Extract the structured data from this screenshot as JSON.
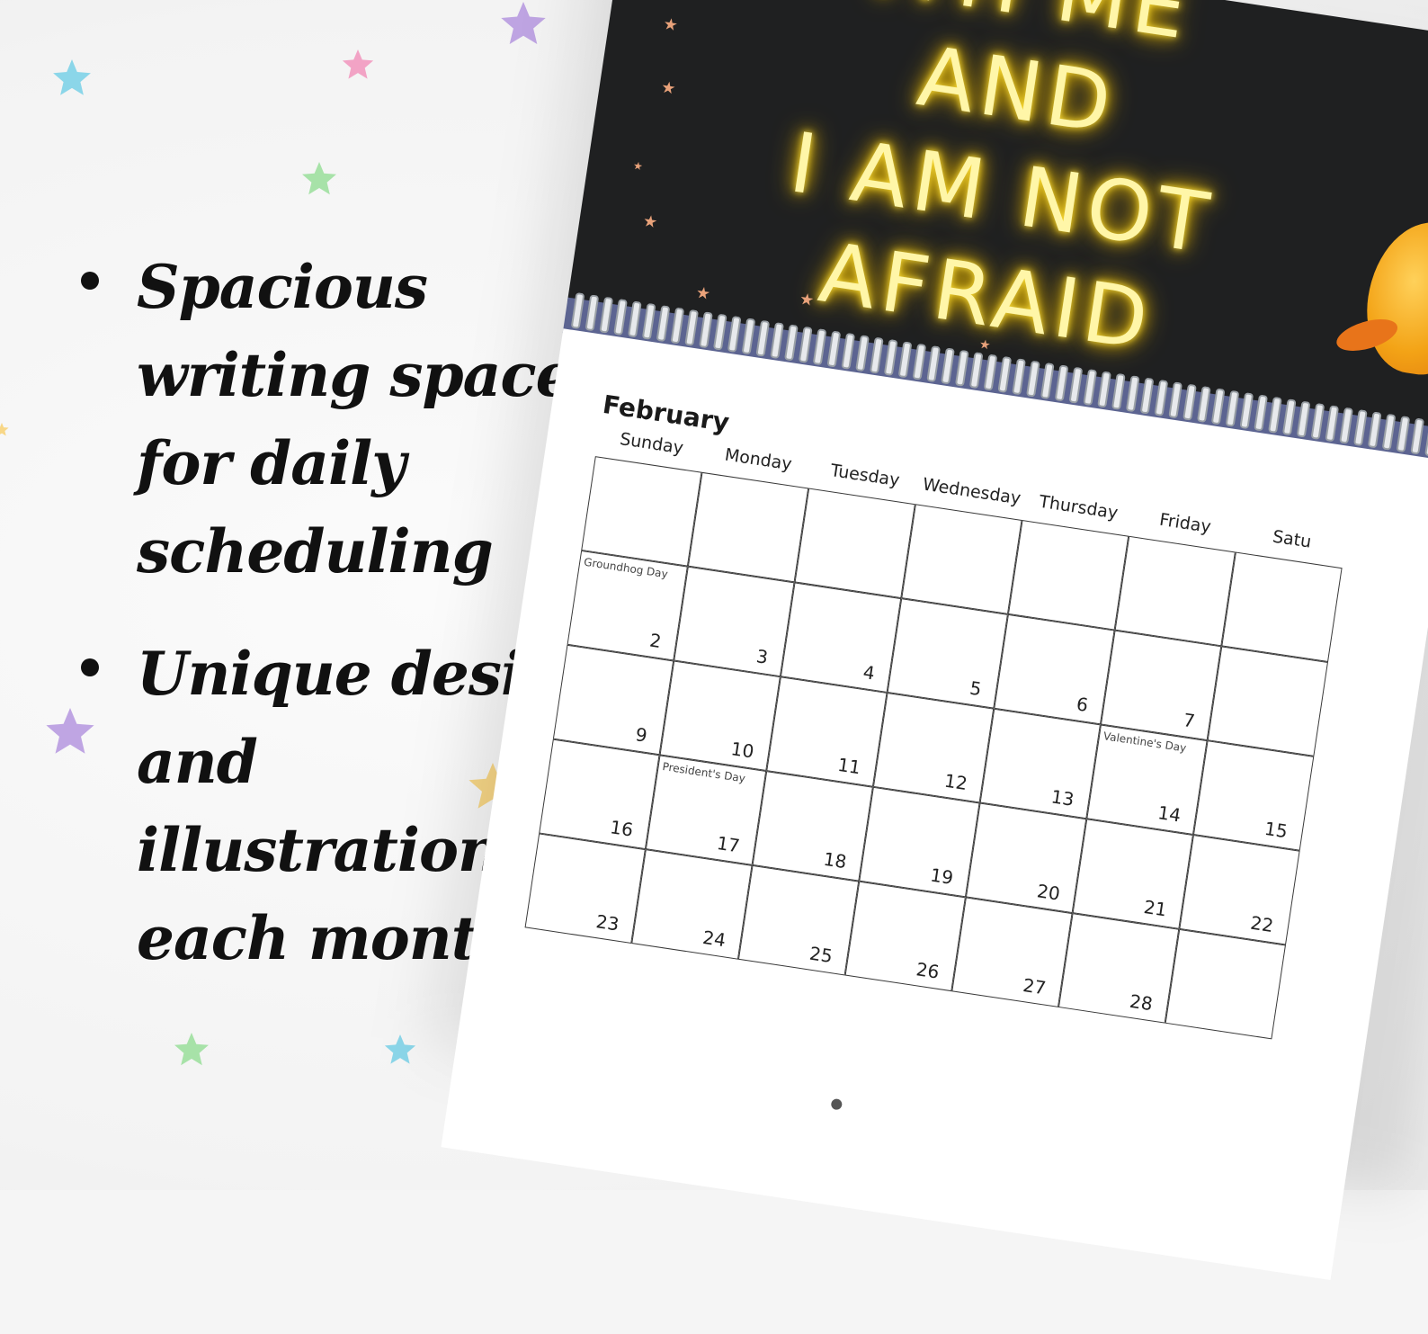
{
  "features": [
    {
      "text": "Spacious writing space for daily scheduling"
    },
    {
      "text": "Unique designs and illustrations each month"
    }
  ],
  "poster": {
    "lines": [
      "ITH ME",
      "AND",
      "I AM NOT",
      "AFRAID"
    ],
    "text_color": "#fff6a8",
    "glow_color": "#f5c400",
    "background": "#1f2021"
  },
  "calendar": {
    "month": "February",
    "weekdays": [
      "Sunday",
      "Monday",
      "Tuesday",
      "Wednesday",
      "Thursday",
      "Friday",
      "Satu"
    ],
    "weeks": [
      [
        {
          "day": "",
          "event": ""
        },
        {
          "day": "",
          "event": ""
        },
        {
          "day": "",
          "event": ""
        },
        {
          "day": "",
          "event": ""
        },
        {
          "day": "",
          "event": ""
        },
        {
          "day": "",
          "event": ""
        },
        {
          "day": "",
          "event": ""
        }
      ],
      [
        {
          "day": "2",
          "event": "Groundhog Day"
        },
        {
          "day": "3",
          "event": ""
        },
        {
          "day": "4",
          "event": ""
        },
        {
          "day": "5",
          "event": ""
        },
        {
          "day": "6",
          "event": ""
        },
        {
          "day": "7",
          "event": ""
        },
        {
          "day": "",
          "event": ""
        }
      ],
      [
        {
          "day": "9",
          "event": ""
        },
        {
          "day": "10",
          "event": ""
        },
        {
          "day": "11",
          "event": ""
        },
        {
          "day": "12",
          "event": ""
        },
        {
          "day": "13",
          "event": ""
        },
        {
          "day": "14",
          "event": "Valentine's Day"
        },
        {
          "day": "15",
          "event": ""
        }
      ],
      [
        {
          "day": "16",
          "event": ""
        },
        {
          "day": "17",
          "event": "President's Day"
        },
        {
          "day": "18",
          "event": ""
        },
        {
          "day": "19",
          "event": ""
        },
        {
          "day": "20",
          "event": ""
        },
        {
          "day": "21",
          "event": ""
        },
        {
          "day": "22",
          "event": ""
        }
      ],
      [
        {
          "day": "23",
          "event": ""
        },
        {
          "day": "24",
          "event": ""
        },
        {
          "day": "25",
          "event": ""
        },
        {
          "day": "26",
          "event": ""
        },
        {
          "day": "27",
          "event": ""
        },
        {
          "day": "28",
          "event": ""
        },
        {
          "day": "",
          "event": ""
        }
      ]
    ]
  },
  "decor": {
    "background_star_icon": "glitter-star-icon",
    "star_colors": [
      "#7fd3e8",
      "#f29ac0",
      "#b89be0",
      "#f7d37a",
      "#9fe0a0"
    ]
  }
}
